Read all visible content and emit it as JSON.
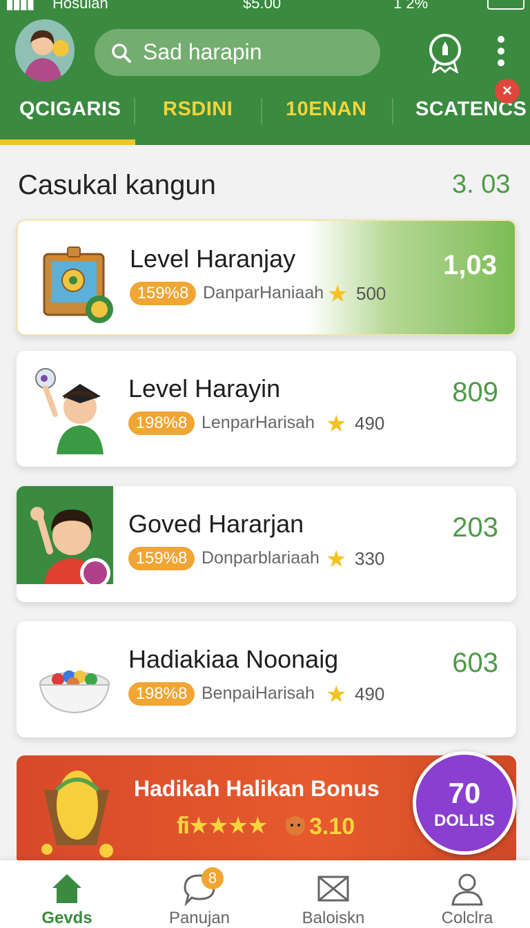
{
  "status_bar": {
    "carrier": "Hosuian",
    "center": "$5.00",
    "right": "1 2%"
  },
  "header": {
    "search_text": "Sad harapin",
    "tabs": [
      {
        "label": "QCIGARIS",
        "active": true
      },
      {
        "label": "RSDINI",
        "active": false
      },
      {
        "label": "10ENAN",
        "active": false
      },
      {
        "label": "SCATENCS",
        "active": false
      }
    ],
    "close_symbol": "×"
  },
  "section": {
    "title": "Casukal kangun",
    "value": "3. 03"
  },
  "cards": [
    {
      "title": "Level Haranjay",
      "pill": "159%8",
      "subtitle": "DanparHaniaah",
      "rating": "500",
      "value": "1,03",
      "icon": "treasure-map-icon"
    },
    {
      "title": "Level Harayin",
      "pill": "198%8",
      "subtitle": "LenparHarisah",
      "rating": "490",
      "value": "809",
      "icon": "boy-graduate-icon"
    },
    {
      "title": "Goved Hararjan",
      "pill": "159%8",
      "subtitle": "Donparblariaah",
      "rating": "330",
      "value": "203",
      "icon": "waving-boy-icon"
    },
    {
      "title": "Hadiakiaa Noonaig",
      "pill": "198%8",
      "subtitle": "BenpaiHarisah",
      "rating": "490",
      "value": "603",
      "icon": "candy-bowl-icon"
    }
  ],
  "bonus": {
    "title": "Hadikah Halikan Bonus",
    "stars_text": "fi★★★★",
    "value": "3.10",
    "circle_number": "70",
    "circle_label": "DOLLIS"
  },
  "bottom_nav": [
    {
      "label": "Gevds",
      "icon": "home-icon",
      "active": true
    },
    {
      "label": "Panujan",
      "icon": "chat-icon",
      "badge": "8",
      "active": false
    },
    {
      "label": "Baloiskn",
      "icon": "mail-icon",
      "active": false
    },
    {
      "label": "Colclra",
      "icon": "profile-icon",
      "active": false
    }
  ],
  "colors": {
    "primary_green": "#3a8a3f",
    "accent_yellow": "#f3c428",
    "pill_orange": "#f0a534",
    "bonus_red": "#d64a2a",
    "bonus_purple": "#8a3fd0"
  }
}
